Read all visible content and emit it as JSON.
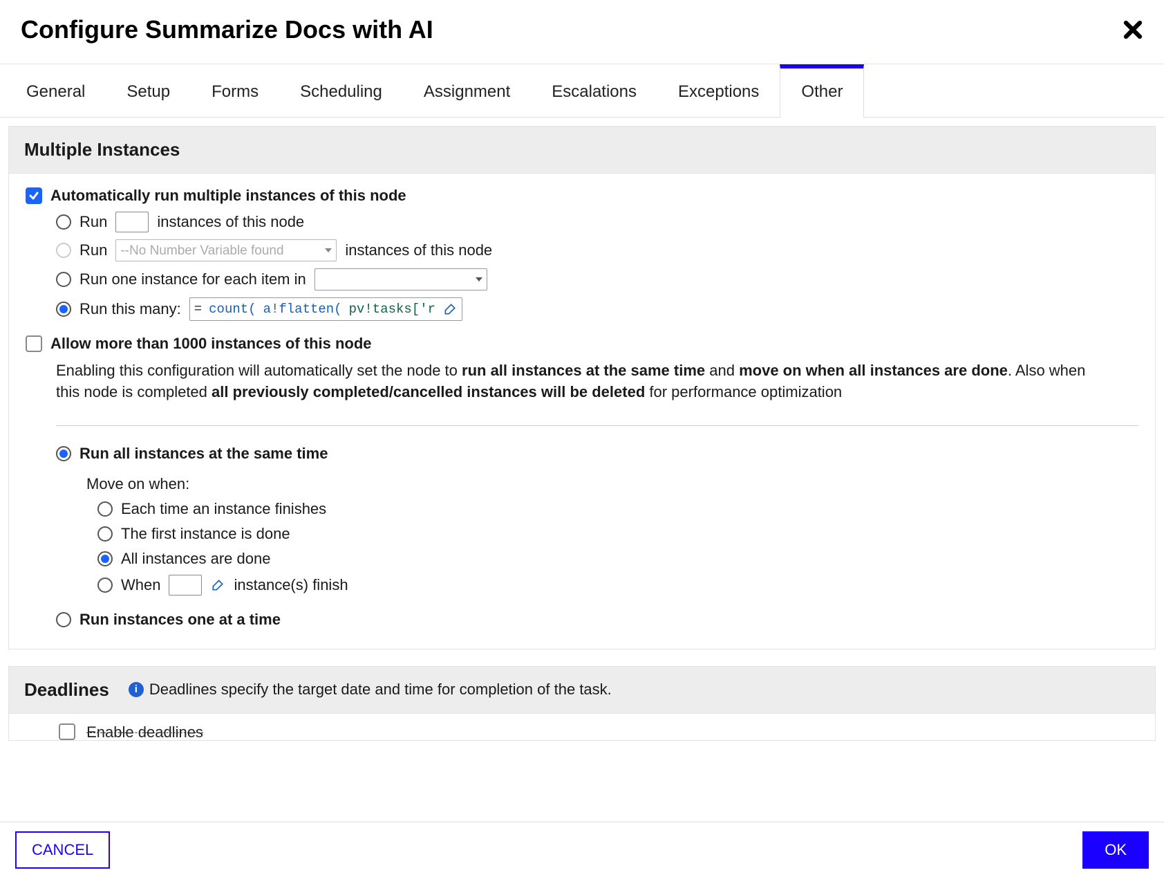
{
  "header": {
    "title": "Configure Summarize Docs with AI"
  },
  "tabs": [
    "General",
    "Setup",
    "Forms",
    "Scheduling",
    "Assignment",
    "Escalations",
    "Exceptions",
    "Other"
  ],
  "active_tab": "Other",
  "sections": {
    "multi": {
      "title": "Multiple Instances",
      "auto_label": "Automatically run multiple instances of this node",
      "auto_checked": true,
      "opts": {
        "run_n": {
          "label_before": "Run",
          "label_after": "instances of this node",
          "value": ""
        },
        "run_var": {
          "label_before": "Run",
          "placeholder": "--No Number Variable found",
          "label_after": "instances of this node",
          "disabled": true
        },
        "run_each": {
          "label": "Run one instance for each item in",
          "value": ""
        },
        "run_expr": {
          "label": "Run this many:",
          "expr_parts": [
            "=",
            "count(",
            "a!flatten(",
            "pv!tasks['r"
          ]
        }
      },
      "selected_opt": "run_expr",
      "allow_1000": {
        "label": "Allow more than 1000 instances of this node",
        "checked": false,
        "help_pre": "Enabling this configuration will automatically set the node to ",
        "help_b1": "run all instances at the same time",
        "help_mid1": " and ",
        "help_b2": "move on when all instances are done",
        "help_mid2": ". Also when this node is completed ",
        "help_b3": "all previously completed/cancelled instances will be deleted",
        "help_post": " for performance optimization"
      },
      "exec": {
        "selected": "all_same",
        "all_same": "Run all instances at the same time",
        "one_at_time": "Run instances one at a time",
        "move_on_label": "Move on when:",
        "move_on_selected": "all_done",
        "move_opts": {
          "each": "Each time an instance finishes",
          "first": "The first instance is done",
          "all_done": "All instances are done",
          "when": {
            "before": "When",
            "after": "instance(s) finish",
            "value": ""
          }
        }
      }
    },
    "deadlines": {
      "title": "Deadlines",
      "info": "Deadlines specify the target date and time for completion of the task.",
      "enable_label_clipped": "Enable deadlines"
    }
  },
  "footer": {
    "cancel": "CANCEL",
    "ok": "OK"
  }
}
